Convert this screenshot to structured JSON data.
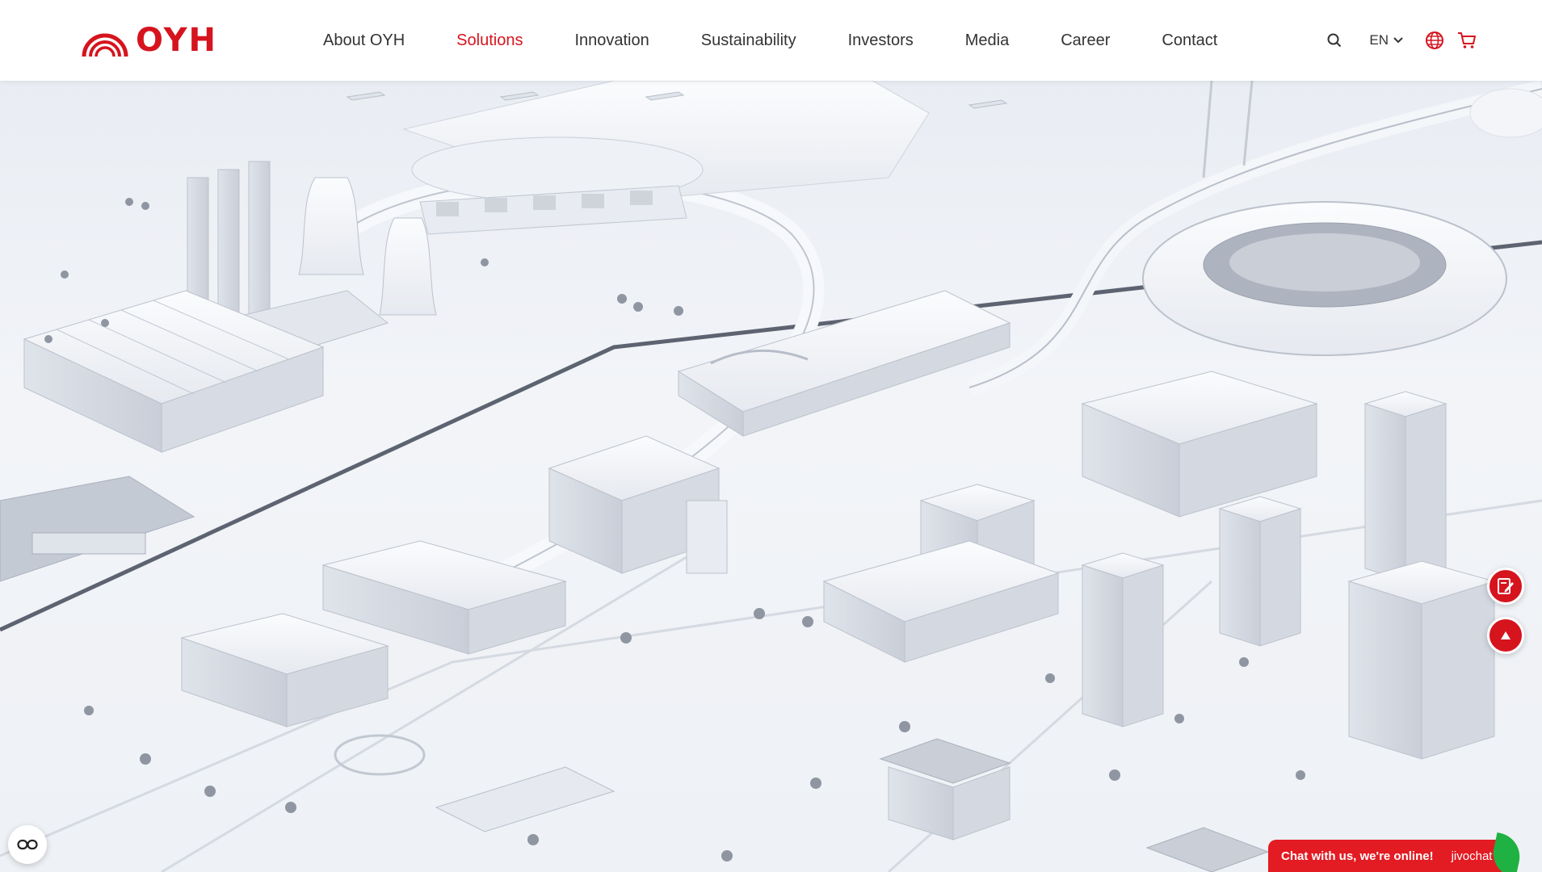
{
  "header": {
    "logo_text": "OYH",
    "nav": [
      {
        "label": "About OYH",
        "active": false
      },
      {
        "label": "Solutions",
        "active": true
      },
      {
        "label": "Innovation",
        "active": false
      },
      {
        "label": "Sustainability",
        "active": false
      },
      {
        "label": "Investors",
        "active": false
      },
      {
        "label": "Media",
        "active": false
      },
      {
        "label": "Career",
        "active": false
      },
      {
        "label": "Contact",
        "active": false
      }
    ],
    "language": "EN",
    "icons": [
      "search-icon",
      "chevron-down-icon",
      "globe-icon",
      "cart-icon"
    ]
  },
  "floating": {
    "icons": [
      "edit-form-icon",
      "arrow-up-icon",
      "cookie-settings-icon"
    ]
  },
  "chat": {
    "text": "Chat with us, we're online!",
    "brand": "jivochat"
  },
  "colors": {
    "brand_red": "#d6141e",
    "text_dark": "#333333",
    "chat_green": "#1fb141"
  }
}
